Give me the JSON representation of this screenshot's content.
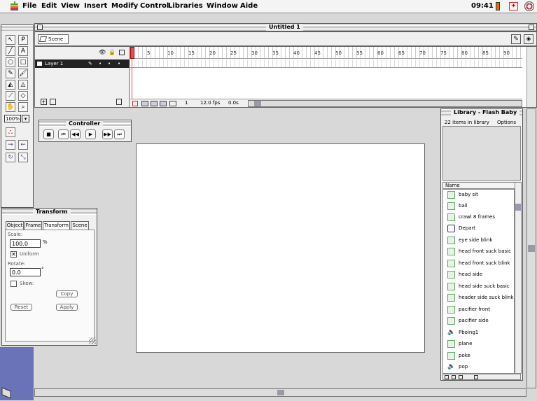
{
  "menubar": {
    "items": [
      "File",
      "Edit",
      "View",
      "Insert",
      "Modify",
      "Control",
      "Libraries",
      "Window",
      "Aide"
    ],
    "clock": "09:41"
  },
  "document": {
    "title": "Untitled 1",
    "scene_label": "Scene 1",
    "layer_name": "Layer 1",
    "frame_numbers": [
      "5",
      "10",
      "15",
      "20",
      "25",
      "30",
      "35",
      "40",
      "45",
      "50",
      "55",
      "60",
      "65",
      "70",
      "75",
      "80",
      "85",
      "90"
    ],
    "current_frame": "1",
    "frame_rate": "12.0 fps",
    "elapsed": "0.0s",
    "zoom": "100%"
  },
  "controller": {
    "title": "Controller",
    "buttons": [
      "■",
      "⏮",
      "◀◀",
      "▶",
      "▶▶",
      "⏭"
    ]
  },
  "transform": {
    "title": "Transform",
    "tabs": [
      "Object",
      "Frame",
      "Transform",
      "Scene"
    ],
    "active_tab": "Transform",
    "scale_label": "Scale:",
    "scale_value": "100.0",
    "scale_unit": "%",
    "uniform_label": "Uniform",
    "uniform_checked": true,
    "rotate_label": "Rotate:",
    "rotate_value": "0.0",
    "rotate_unit": "°",
    "skew_label": "Skew:",
    "skew_checked": false,
    "copy_label": "Copy",
    "reset_label": "Reset",
    "apply_label": "Apply"
  },
  "library": {
    "title": "Library - Flash Baby",
    "count_text": "22 items in library",
    "options_label": "Options",
    "column_name": "Name",
    "items": [
      {
        "name": "baby sit",
        "type": "graphic"
      },
      {
        "name": "ball",
        "type": "graphic"
      },
      {
        "name": "crawl 8 frames",
        "type": "graphic"
      },
      {
        "name": "Depart",
        "type": "folder"
      },
      {
        "name": "eye side blink",
        "type": "graphic"
      },
      {
        "name": "head front suck basic",
        "type": "graphic"
      },
      {
        "name": "head front suck blink",
        "type": "graphic"
      },
      {
        "name": "head side",
        "type": "graphic"
      },
      {
        "name": "head side suck basic",
        "type": "graphic"
      },
      {
        "name": "header side suck blink",
        "type": "graphic"
      },
      {
        "name": "pacifier front",
        "type": "graphic"
      },
      {
        "name": "pacifier side",
        "type": "graphic"
      },
      {
        "name": "Pboing1",
        "type": "sound"
      },
      {
        "name": "plane",
        "type": "graphic"
      },
      {
        "name": "poke",
        "type": "graphic"
      },
      {
        "name": "pop",
        "type": "sound"
      }
    ]
  },
  "colors": {
    "desktop": "#d8d8d8",
    "stage": "#ffffff",
    "playhead": "#e05050",
    "desktop_accent": "#6b73b8"
  }
}
